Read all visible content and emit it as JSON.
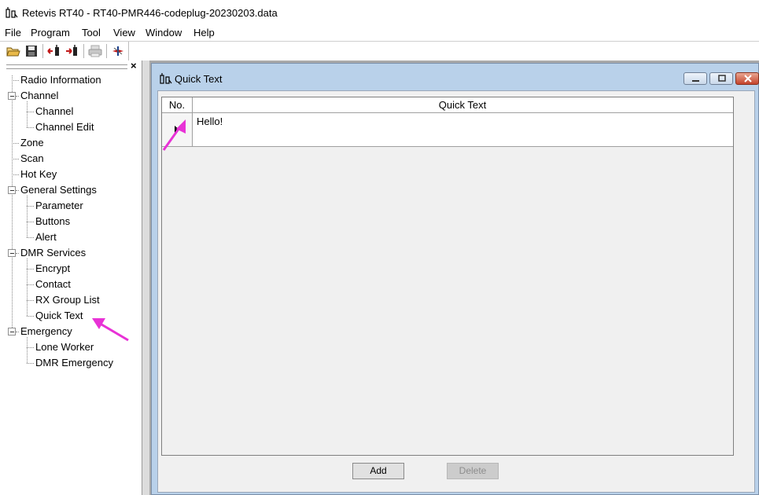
{
  "window": {
    "title": "Retevis RT40 - RT40-PMR446-codeplug-20230203.data",
    "icon": "radio-app-icon"
  },
  "menu": [
    "File",
    "Program",
    "Tool",
    "View",
    "Window",
    "Help"
  ],
  "toolbar": [
    "open-folder-icon",
    "save-icon",
    "read-radio-icon",
    "write-radio-icon",
    "print-icon",
    "about-icon"
  ],
  "sidebar": {
    "close_glyph": "×",
    "tree": [
      {
        "label": "Radio Information"
      },
      {
        "label": "Channel",
        "children": [
          "Channel",
          "Channel Edit"
        ]
      },
      {
        "label": "Zone"
      },
      {
        "label": "Scan"
      },
      {
        "label": "Hot Key"
      },
      {
        "label": "General Settings",
        "children": [
          "Parameter",
          "Buttons",
          "Alert"
        ]
      },
      {
        "label": "DMR Services",
        "children": [
          "Encrypt",
          "Contact",
          "RX Group List",
          "Quick Text"
        ]
      },
      {
        "label": "Emergency",
        "children": [
          "Lone Worker",
          "DMR Emergency"
        ]
      }
    ]
  },
  "child_window": {
    "title": "Quick Text",
    "grid": {
      "columns": [
        "No.",
        "Quick Text"
      ],
      "rows": [
        {
          "text": "Hello!"
        }
      ]
    },
    "buttons": {
      "add": "Add",
      "delete": "Delete"
    }
  },
  "annotation_color": "#e832d6"
}
